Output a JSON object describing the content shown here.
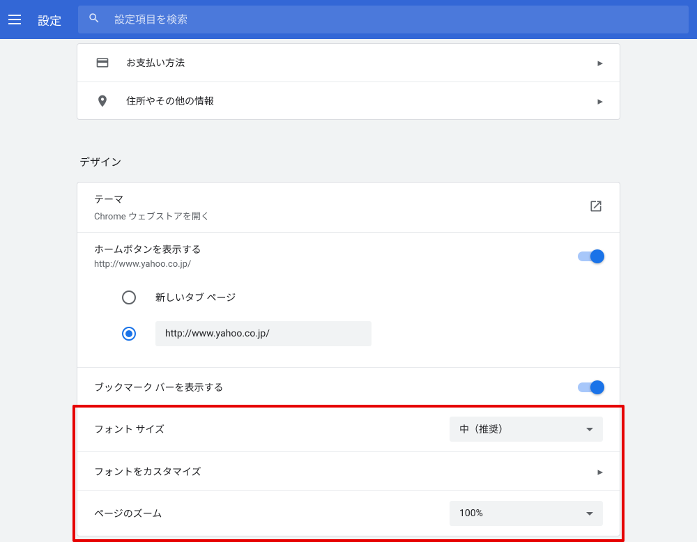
{
  "header": {
    "title": "設定",
    "search_placeholder": "設定項目を検索"
  },
  "autofill": {
    "payment_label": "お支払い方法",
    "address_label": "住所やその他の情報"
  },
  "design": {
    "heading": "デザイン",
    "theme": {
      "title": "テーマ",
      "subtitle": "Chrome ウェブストアを開く"
    },
    "home_button": {
      "title": "ホームボタンを表示する",
      "subtitle": "http://www.yahoo.co.jp/",
      "radio": {
        "newtab_label": "新しいタブ ページ",
        "url_value": "http://www.yahoo.co.jp/"
      }
    },
    "bookmark_bar_label": "ブックマーク バーを表示する",
    "font_size": {
      "label": "フォント サイズ",
      "value": "中（推奨）"
    },
    "font_customize_label": "フォントをカスタマイズ",
    "page_zoom": {
      "label": "ページのズーム",
      "value": "100%"
    }
  }
}
